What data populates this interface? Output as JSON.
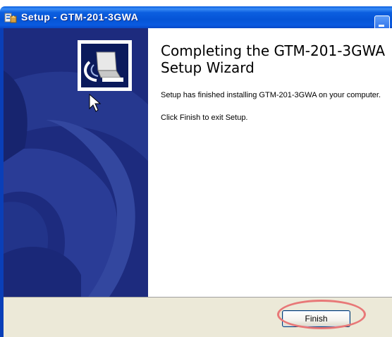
{
  "window": {
    "title": "Setup - GTM-201-3GWA",
    "colors": {
      "titlebar": "#0554d6",
      "banner": "#1d2b7e",
      "buttonbar": "#ece9d8",
      "highlight": "#e87878"
    }
  },
  "content": {
    "heading": "Completing the GTM-201-3GWA\nSetup Wizard",
    "line1": "Setup has finished installing GTM-201-3GWA on your computer.",
    "line2": "Click Finish to exit Setup."
  },
  "buttons": {
    "finish": "Finish"
  },
  "icons": {
    "title": "setup-icon",
    "wizard": "computer-icon",
    "cursor": "mouse-pointer-icon"
  }
}
